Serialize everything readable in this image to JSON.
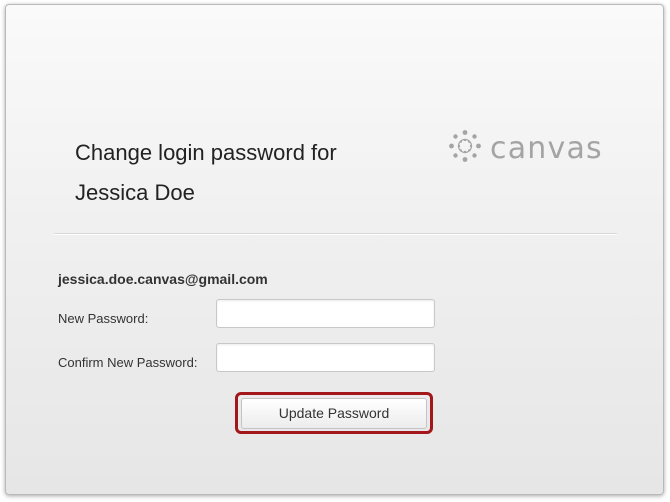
{
  "header": {
    "title_line1": "Change login password for",
    "title_line2": "Jessica Doe",
    "logo_text": "canvas",
    "logo_icon": "canvas-logo-icon"
  },
  "form": {
    "email": "jessica.doe.canvas@gmail.com",
    "new_password_label": "New Password:",
    "new_password_value": "",
    "confirm_password_label": "Confirm New Password:",
    "confirm_password_value": "",
    "submit_label": "Update Password"
  },
  "colors": {
    "highlight_border": "#a3161a",
    "logo_gray": "#a4a4a4"
  }
}
